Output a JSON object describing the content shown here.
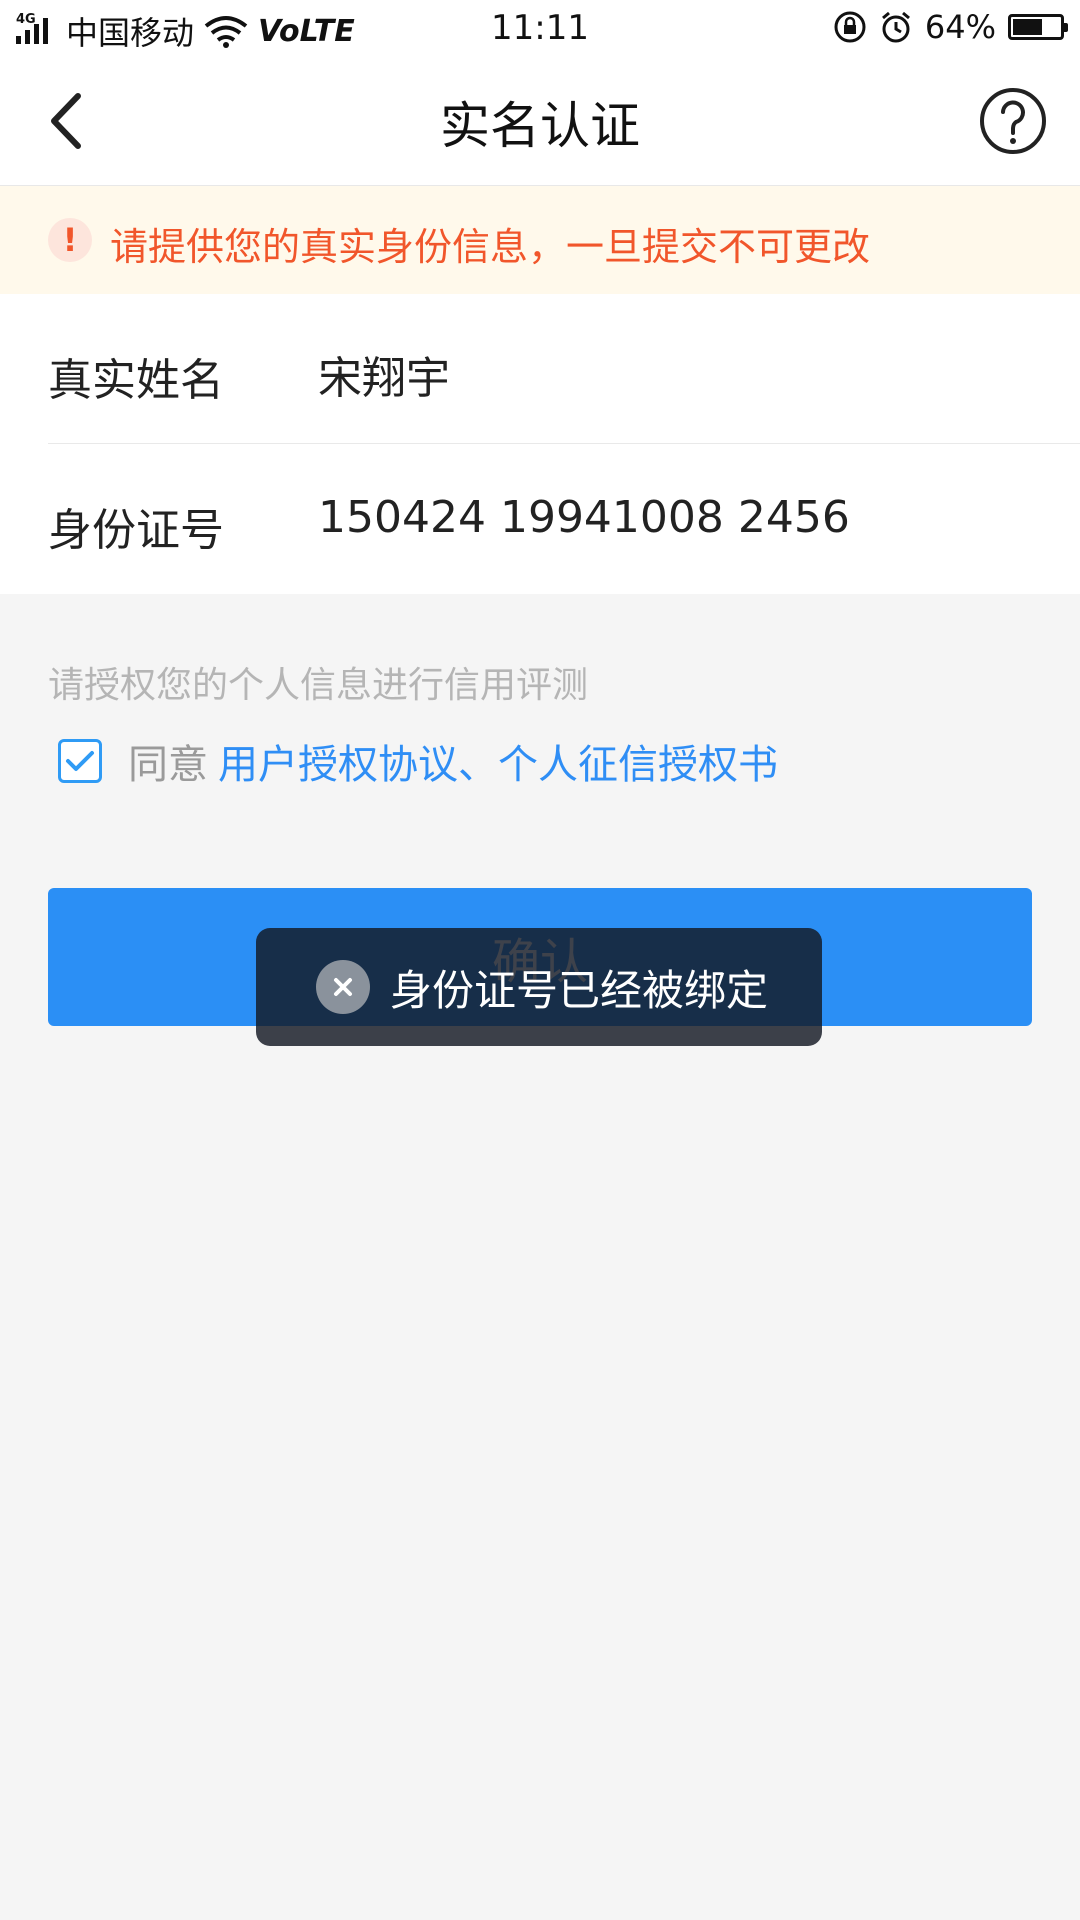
{
  "status_bar": {
    "network_tag": "4G",
    "carrier": "中国移动",
    "volte": "VoLTE",
    "time": "11:11",
    "battery_percent": "64%",
    "battery_level": 0.64
  },
  "nav": {
    "title": "实名认证"
  },
  "warning": {
    "icon_glyph": "!",
    "text": "请提供您的真实身份信息，一旦提交不可更改"
  },
  "form": {
    "name_label": "真实姓名",
    "name_value": "宋翔宇",
    "id_label": "身份证号",
    "id_value": "150424 19941008 2456"
  },
  "auth": {
    "hint": "请授权您的个人信息进行信用评测",
    "agree_prefix": "同意",
    "agree_link": "用户授权协议、个人征信授权书",
    "checked": true
  },
  "confirm_button": {
    "label": "确认"
  },
  "toast": {
    "text": "身份证号已经被绑定"
  },
  "colors": {
    "primary": "#2b8ff5",
    "warning": "#f1562b",
    "warning_bg": "#fff9eb",
    "page_bg": "#f5f5f5"
  }
}
